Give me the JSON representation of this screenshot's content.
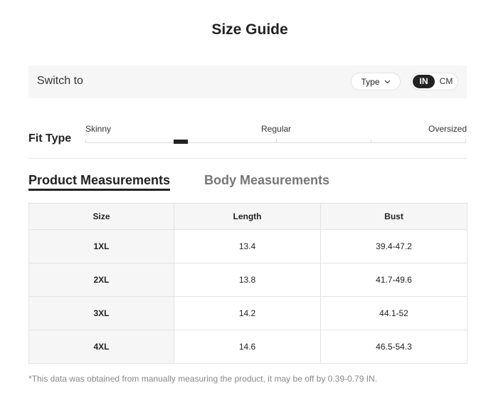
{
  "title": "Size Guide",
  "switch_bar": {
    "label": "Switch to",
    "type_dropdown": "Type",
    "units": [
      "IN",
      "CM"
    ],
    "selected_unit": "IN"
  },
  "fit": {
    "label": "Fit Type",
    "scale": [
      "Skinny",
      "Regular",
      "Oversized"
    ]
  },
  "tabs": [
    {
      "label": "Product Measurements",
      "active": true
    },
    {
      "label": "Body Measurements",
      "active": false
    }
  ],
  "table": {
    "headers": [
      "Size",
      "Length",
      "Bust"
    ],
    "rows": [
      [
        "1XL",
        "13.4",
        "39.4-47.2"
      ],
      [
        "2XL",
        "13.8",
        "41.7-49.6"
      ],
      [
        "3XL",
        "14.2",
        "44.1-52"
      ],
      [
        "4XL",
        "14.6",
        "46.5-54.3"
      ]
    ]
  },
  "footnote": "*This data was obtained from manually measuring the product, it may be off by 0.39-0.79 IN.",
  "colors": {
    "text": "#222222",
    "muted": "#767676",
    "panel": "#f6f6f6",
    "border": "#e3e3e3",
    "active_toggle": "#222222"
  },
  "icons": {
    "dropdown": "chevron-down-icon"
  }
}
